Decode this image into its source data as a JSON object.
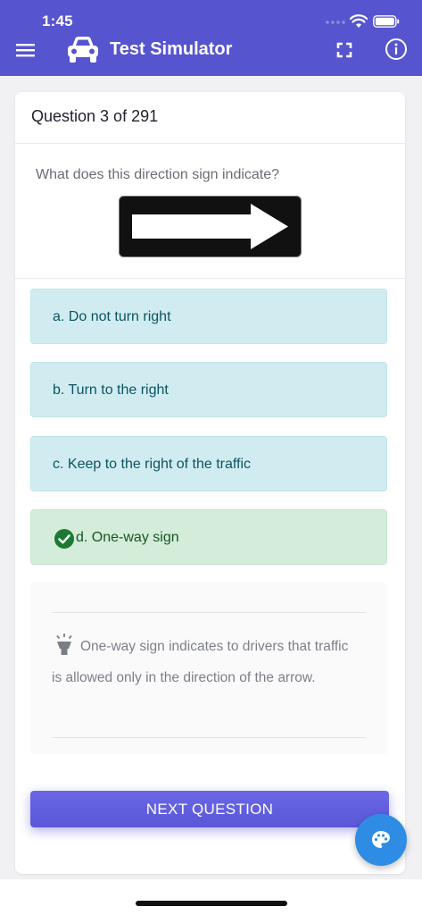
{
  "status_bar": {
    "time": "1:45"
  },
  "header": {
    "title": "Test Simulator",
    "menu_icon": "hamburger-menu-icon",
    "logo_icon": "car-icon",
    "fullscreen_icon": "fullscreen-icon",
    "info_icon": "info-icon"
  },
  "question": {
    "counter": "Question 3 of 291",
    "text": "What does this direction sign indicate?",
    "image_icon": "one-way-arrow-sign"
  },
  "options": [
    {
      "label": "a. Do not turn right",
      "state": "neutral"
    },
    {
      "label": "b. Turn to the right",
      "state": "neutral"
    },
    {
      "label": "c. Keep to the right of the traffic",
      "state": "neutral"
    },
    {
      "label": "d. One-way sign",
      "state": "correct"
    }
  ],
  "explanation": {
    "icon": "lightbulb-icon",
    "text": "One-way sign indicates to drivers that traffic is allowed only in the direction of the arrow."
  },
  "next_button": {
    "label": "NEXT QUESTION"
  },
  "fab": {
    "icon": "palette-icon"
  },
  "colors": {
    "header": "#5754cf",
    "option_neutral_bg": "#d1ecf1",
    "option_neutral_text": "#0c5460",
    "option_correct_bg": "#d4edda",
    "option_correct_text": "#155724",
    "next_button": "#5a57d8",
    "fab": "#2f8ce4"
  }
}
